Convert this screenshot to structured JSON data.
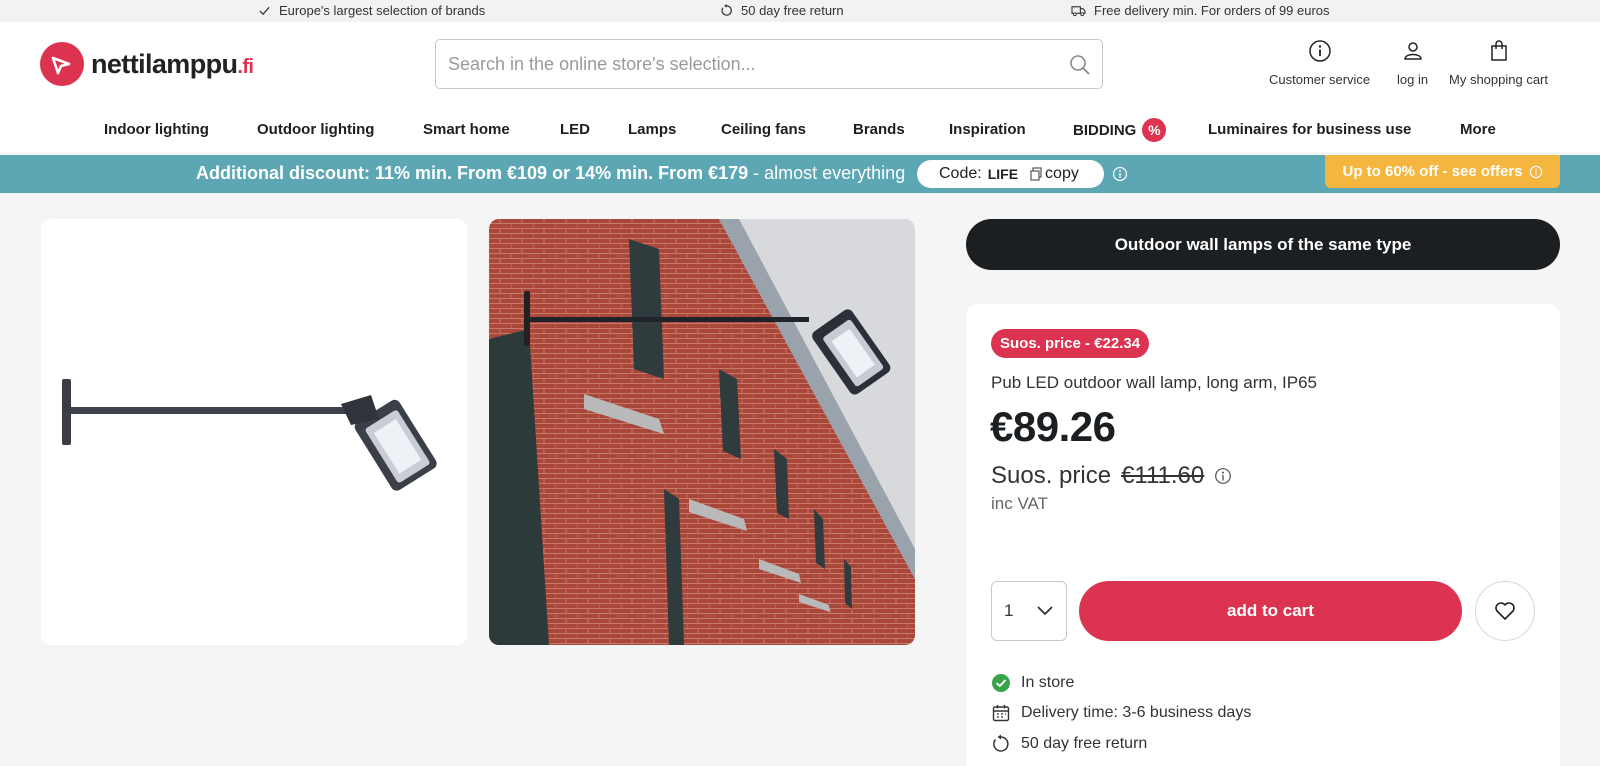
{
  "topbar": {
    "items": [
      {
        "icon": "check-icon",
        "text": "Europe's largest selection of brands"
      },
      {
        "icon": "return-icon",
        "text": "50 day free return"
      },
      {
        "icon": "truck-icon",
        "text": "Free delivery min. For orders of 99 euros"
      }
    ]
  },
  "header": {
    "logo_text": "nettilamppu",
    "logo_tld": ".fi",
    "search_placeholder": "Search in the online store's selection...",
    "actions": [
      {
        "icon": "info-icon",
        "label": "Customer service"
      },
      {
        "icon": "user-icon",
        "label": "log in"
      },
      {
        "icon": "bag-icon",
        "label": "My shopping cart"
      }
    ]
  },
  "nav": {
    "items": [
      "Indoor lighting",
      "Outdoor lighting",
      "Smart home",
      "LED",
      "Lamps",
      "Ceiling fans",
      "Brands",
      "Inspiration",
      "BIDDING",
      "Luminaires for business use",
      "More"
    ],
    "bidding_badge": "%"
  },
  "promo": {
    "bold_text": "Additional discount: 11% min. From €109 or 14% min. From €179",
    "rest_text": " - almost everything",
    "code_label": "Code:",
    "code_value": "LIFE",
    "copy_label": "copy",
    "offer_label": "Up to 60% off - see offers"
  },
  "product": {
    "same_type_label": "Outdoor wall lamps of the same type",
    "sale_badge": "Suos. price - €22.34",
    "title": "Pub LED outdoor wall lamp, long arm, IP65",
    "price": "€89.26",
    "rrp_label": "Suos. price",
    "rrp_value": "€111.60",
    "vat_label": "inc VAT",
    "quantity": "1",
    "add_to_cart": "add to cart",
    "stock": "In store",
    "delivery": "Delivery time: 3-6 business days",
    "returns": "50 day free return"
  },
  "colors": {
    "brand_red": "#dc3450",
    "promo_teal": "#5da7b5",
    "offer_yellow": "#f4b63f",
    "dark": "#1c1f22",
    "stock_green": "#3aa44a"
  }
}
